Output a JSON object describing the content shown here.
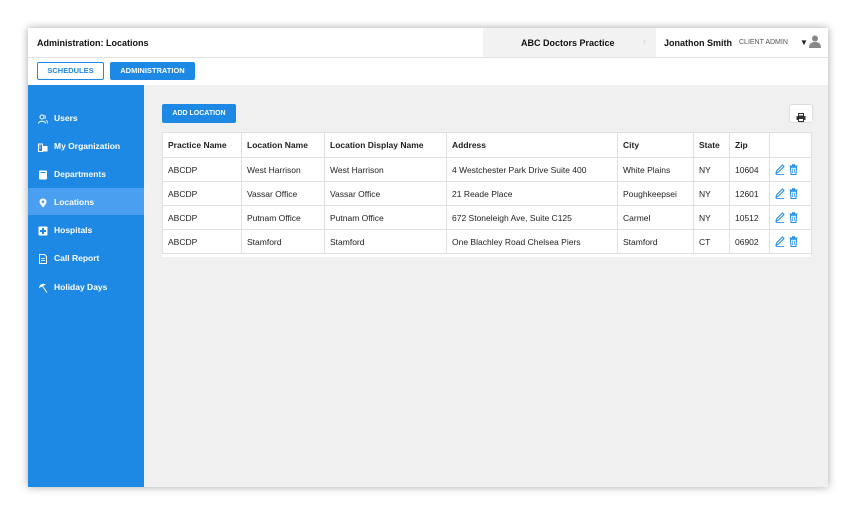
{
  "header": {
    "title": "Administration: Locations",
    "practice": "ABC Doctors Practice",
    "user_name": "Jonathon Smith",
    "user_role": "CLIENT ADMIN"
  },
  "tabs": [
    {
      "label": "SCHEDULES",
      "active": false
    },
    {
      "label": "ADMINISTRATION",
      "active": true
    }
  ],
  "sidebar": {
    "items": [
      {
        "label": "Users",
        "icon": "users-icon"
      },
      {
        "label": "My Organization",
        "icon": "building-icon"
      },
      {
        "label": "Departments",
        "icon": "book-icon"
      },
      {
        "label": "Locations",
        "icon": "map-pin-icon",
        "active": true
      },
      {
        "label": "Hospitals",
        "icon": "hospital-cross-icon"
      },
      {
        "label": "Call Report",
        "icon": "document-icon"
      },
      {
        "label": "Holiday Days",
        "icon": "umbrella-icon"
      }
    ]
  },
  "toolbar": {
    "add_label": "ADD LOCATION",
    "print_icon": "print-icon"
  },
  "table": {
    "headers": [
      "Practice Name",
      "Location Name",
      "Location Display Name",
      "Address",
      "City",
      "State",
      "Zip",
      ""
    ],
    "rows": [
      [
        "ABCDP",
        "West Harrison",
        "West Harrison",
        "4 Westchester Park Drive Suite 400",
        "White Plains",
        "NY",
        "10604"
      ],
      [
        "ABCDP",
        "Vassar Office",
        "Vassar Office",
        "21 Reade Place",
        "Poughkeepsei",
        "NY",
        "12601"
      ],
      [
        "ABCDP",
        "Putnam Office",
        "Putnam Office",
        "672 Stoneleigh Ave, Suite C125",
        "Carmel",
        "NY",
        "10512"
      ],
      [
        "ABCDP",
        "Stamford",
        "Stamford",
        "One Blachley Road Chelsea Piers",
        "Stamford",
        "CT",
        "06902"
      ]
    ]
  },
  "colors": {
    "accent": "#1e88e5",
    "sidebar_active": "#4a9ff0",
    "background": "#f0f0f0"
  }
}
